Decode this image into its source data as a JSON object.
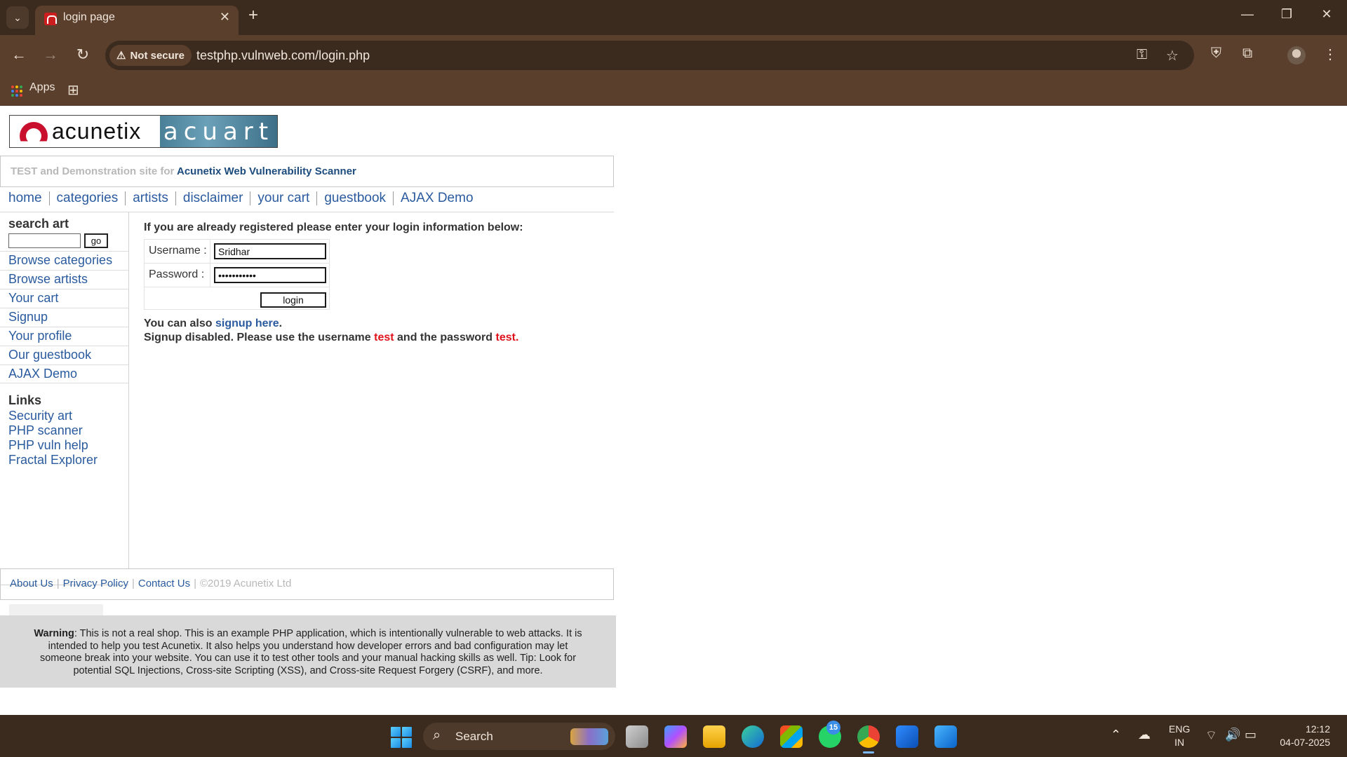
{
  "browser": {
    "tab_title": "login page",
    "new_tab_label": "+",
    "security_label": "Not secure",
    "url": "testphp.vulnweb.com/login.php",
    "bookmarks_apps_label": "Apps"
  },
  "site": {
    "logo_left": "acunetix",
    "logo_right": "acuart",
    "banner_prefix": "TEST and Demonstration site for",
    "banner_product": "Acunetix Web Vulnerability Scanner",
    "topnav": [
      "home",
      "categories",
      "artists",
      "disclaimer",
      "your cart",
      "guestbook",
      "AJAX Demo"
    ],
    "search_title": "search art",
    "search_value": "",
    "search_button": "go",
    "sidebar_links": [
      "Browse categories",
      "Browse artists",
      "Your cart",
      "Signup",
      "Your profile",
      "Our guestbook",
      "AJAX Demo"
    ],
    "links_title": "Links",
    "links": [
      "Security art",
      "PHP scanner",
      "PHP vuln help",
      "Fractal Explorer"
    ]
  },
  "login": {
    "heading": "If you are already registered please enter your login information below:",
    "username_label": "Username :",
    "username_value": "Sridhar",
    "password_label": "Password :",
    "password_value": "•••••••••••",
    "button": "login",
    "signup_prefix": "You can also",
    "signup_link": "signup here",
    "signup_suffix": ".",
    "disabled_a": "Signup disabled. Please use the username",
    "disabled_user": "test",
    "disabled_b": "and the password",
    "disabled_pass": "test",
    "disabled_end": "."
  },
  "footer": {
    "about": "About Us",
    "privacy": "Privacy Policy",
    "contact": "Contact Us",
    "sep": "|",
    "copyright": "©2019 Acunetix Ltd"
  },
  "warning": {
    "title": "Warning",
    "body": ": This is not a real shop. This is an example PHP application, which is intentionally vulnerable to web attacks. It is intended to help you test Acunetix. It also helps you understand how developer errors and bad configuration may let someone break into your website. You can use it to test other tools and your manual hacking skills as well. Tip: Look for potential SQL Injections, Cross-site Scripting (XSS), and Cross-site Request Forgery (CSRF), and more."
  },
  "taskbar": {
    "search_label": "Search",
    "whatsapp_badge": "15",
    "lang_1": "ENG",
    "lang_2": "IN",
    "time": "12:12",
    "date": "04-07-2025"
  },
  "colors": {
    "chrome_dark": "#3b2a1e",
    "chrome_mid": "#5a3f2c",
    "link_blue": "#2a5b9f",
    "warning_red": "#e0121b"
  }
}
